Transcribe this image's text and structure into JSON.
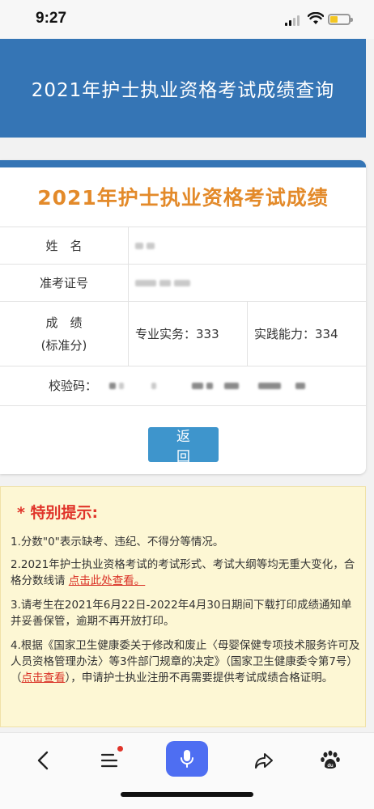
{
  "status_bar": {
    "time": "9:27"
  },
  "header": {
    "title": "2021年护士执业资格考试成绩查询"
  },
  "card": {
    "title": "2021年护士执业资格考试成绩",
    "rows": {
      "name_label": "姓　名",
      "ticket_label": "准考证号",
      "score_label_line1": "成　绩",
      "score_label_line2": "(标准分)",
      "score_professional": "专业实务：333",
      "score_practice": "实践能力：334",
      "check_code_label": "校验码："
    },
    "back_button": "返　回"
  },
  "notice": {
    "title": "* 特别提示:",
    "item1": "1.分数\"0\"表示缺考、违纪、不得分等情况。",
    "item2_text": "2.2021年护士执业资格考试的考试形式、考试大纲等均无重大变化，合格分数线请",
    "item2_link": "点击此处查看。",
    "item3": "3.请考生在2021年6月22日-2022年4月30日期间下载打印成绩通知单并妥善保管，逾期不再开放打印。",
    "item4_text_a": "4.根据《国家卫生健康委关于修改和废止〈母婴保健专项技术服务许可及人员资格管理办法〉等3件部门规章的决定》（国家卫生健康委令第7号）（",
    "item4_link": "点击查看",
    "item4_text_b": "），申请护士执业注册不再需要提供考试成绩合格证明。"
  },
  "bottom_nav": {
    "icons": [
      "back-icon",
      "menu-icon",
      "mic-icon",
      "share-icon",
      "baidu-paw-icon"
    ],
    "baidu_text": "du"
  },
  "colors": {
    "header_blue": "#3575b5",
    "title_orange": "#e38a2a",
    "button_blue": "#3e95cc",
    "notice_bg": "#fdf7d4",
    "alert_red": "#e0342a",
    "mic_blue": "#4e6ef2"
  }
}
